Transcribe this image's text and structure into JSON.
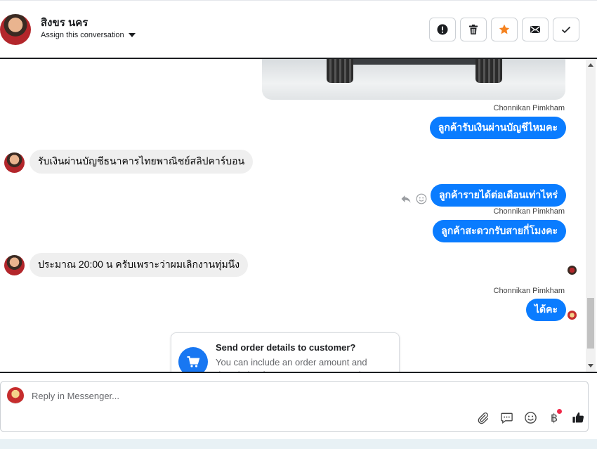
{
  "header": {
    "contact_name": "สิงขร นคร",
    "assign_label": "Assign this conversation",
    "actions": [
      {
        "name": "mark-spam-button",
        "icon": "alert-icon"
      },
      {
        "name": "delete-button",
        "icon": "trash-icon"
      },
      {
        "name": "star-button",
        "icon": "star-icon"
      },
      {
        "name": "mark-unread-button",
        "icon": "envelope-icon"
      },
      {
        "name": "mark-done-button",
        "icon": "check-icon"
      }
    ]
  },
  "conversation": {
    "messages": [
      {
        "id": "m1",
        "direction": "out",
        "sender": "Chonnikan Pimkham",
        "text": "ลูกค้ารับเงินผ่านบัญชีไหมคะ"
      },
      {
        "id": "m2",
        "direction": "in",
        "text": "รับเงินผ่านบัญชีธนาคารไทยพาณิชย์สลิปคาร์บอน"
      },
      {
        "id": "m3",
        "direction": "out",
        "text": "ลูกค้ารายได้ต่อเดือนเท่าไหร่"
      },
      {
        "id": "m4",
        "direction": "out",
        "sender": "Chonnikan Pimkham",
        "text": "ลูกค้าสะดวกรับสายกี่โมงคะ"
      },
      {
        "id": "m5",
        "direction": "in",
        "text": "ประมาณ 20:00 น ครับเพราะว่าผมเลิกงานทุ่มนึง"
      },
      {
        "id": "m6",
        "direction": "out",
        "sender": "Chonnikan Pimkham",
        "text": "ได้คะ"
      }
    ],
    "order_card": {
      "title": "Send order details to customer?",
      "description": "You can include an order amount and description for your customer to review."
    }
  },
  "composer": {
    "placeholder": "Reply in Messenger...",
    "tools": [
      "paperclip-icon",
      "saved-replies-icon",
      "emoji-icon",
      "baht-icon",
      "thumbs-up-icon"
    ],
    "baht_symbol": "฿"
  },
  "colors": {
    "outgoing_bubble": "#0a7cff",
    "incoming_bubble": "#efefef",
    "star": "#f5821f",
    "notification": "#f02849"
  }
}
